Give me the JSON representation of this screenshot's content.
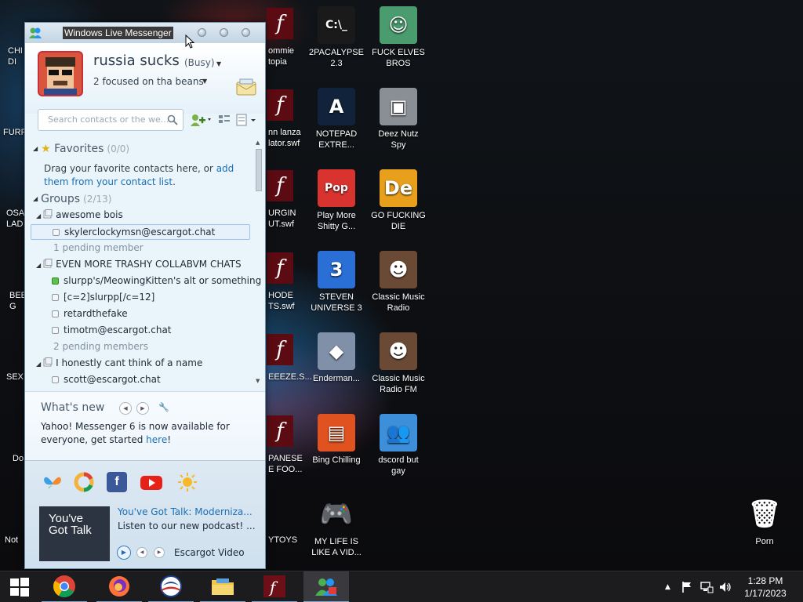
{
  "desktop": {
    "left_partial_labels": [
      {
        "text": "CHI\nDI"
      },
      {
        "text": "FURR"
      },
      {
        "text": "OSA\nLAD"
      },
      {
        "text": "BEE\nG"
      },
      {
        "text": "SEX"
      },
      {
        "text": "Do"
      },
      {
        "text": "Not"
      }
    ],
    "mid_partial_labels": [
      {
        "text": "ommie\ntopia"
      },
      {
        "text": "nn lanza\nlator.swf"
      },
      {
        "text": "URGIN\nUT.swf"
      },
      {
        "text": "HODE\nTS.swf"
      },
      {
        "text": "EEEZE.S..."
      },
      {
        "text": "PANESE\nE FOO..."
      },
      {
        "text": "YTOYS"
      }
    ],
    "icons": [
      {
        "label": "2PACALYPSE\n2.3",
        "icon": "cmd-icon",
        "color": "#1a1a1a"
      },
      {
        "label": "FUCK ELVES\nBROS",
        "icon": "elf-icon",
        "color": "#4a9b6e"
      },
      {
        "label": "NOTEPAD\nEXTRE...",
        "icon": "notepad-icon",
        "color": "#10233a"
      },
      {
        "label": "Deez Nutz\nSpy",
        "icon": "windows-stack-icon",
        "color": "#8a8f96"
      },
      {
        "label": "Play More\nShitty G...",
        "icon": "popcap-icon",
        "color": "#d8332f"
      },
      {
        "label": "GO FUCKING\nDIE",
        "icon": "de-icon",
        "color": "#e8a01c"
      },
      {
        "label": "STEVEN\nUNIVERSE 3",
        "icon": "three-badge-icon",
        "color": "#2a6fd6"
      },
      {
        "label": "Classic Music\nRadio",
        "icon": "portrait-icon",
        "color": "#6b4a35"
      },
      {
        "label": "Enderman...",
        "icon": "diamond-icon",
        "color": "#7f90a8"
      },
      {
        "label": "Classic Music\nRadio FM",
        "icon": "portrait-fm-icon",
        "color": "#6b4a35"
      },
      {
        "label": "Bing Chilling",
        "icon": "book-icon",
        "color": "#e0521f"
      },
      {
        "label": "dscord but\ngay",
        "icon": "messenger-people-icon",
        "color": "#3c8fd8"
      },
      {
        "label": "MY LIFE IS\nLIKE A VID...",
        "icon": "gamepad-icon",
        "color": "#e8e8e8"
      },
      {
        "label": "Porn",
        "icon": "recycle-bin-icon",
        "color": "#dfe4e8"
      }
    ]
  },
  "messenger": {
    "window_title": "Windows Live Messenger",
    "username": "russia sucks",
    "status": "(Busy)",
    "personal_message": "2 focused on tha beans",
    "search_placeholder": "Search contacts or the we...",
    "favorites": {
      "title": "Favorites",
      "count": "(0/0)",
      "text_before": "Drag your favorite contacts here, or ",
      "link": "add them from your contact list",
      "text_after": "."
    },
    "groups": {
      "title": "Groups",
      "count": "(2/13)",
      "list": [
        {
          "name": "awesome bois",
          "contacts": [
            {
              "name": "skylerclockymsn@escargot.chat",
              "online": false,
              "selected": true
            }
          ],
          "pending": "1 pending member"
        },
        {
          "name": "EVEN MORE TRASHY COLLABVM CHATS",
          "contacts": [
            {
              "name": "slurpp's/MeowingKitten's alt or something",
              "online": true
            },
            {
              "name": "[c=2]slurpp[/c=12]",
              "online": false
            },
            {
              "name": "retardthefake",
              "online": false
            },
            {
              "name": "timotm@escargot.chat",
              "online": false
            }
          ],
          "pending": "2 pending members"
        },
        {
          "name": "I honestly cant think of a name",
          "contacts": [
            {
              "name": "scott@escargot.chat",
              "online": false
            }
          ]
        }
      ]
    },
    "whats_new": {
      "title": "What's new",
      "text": "Yahoo! Messenger 6 is now available for everyone, get started ",
      "link": "here",
      "text_after": "!"
    },
    "social_icons": [
      "windows-live-butterfly-icon",
      "chrome-c-icon",
      "facebook-icon",
      "youtube-icon",
      "sun-icon"
    ],
    "promo": {
      "thumb_text": "You've Got Talk",
      "title": "You've Got Talk: Moderniza...",
      "subtitle": "Listen to our new podcast! ...",
      "source": "Escargot Video"
    }
  },
  "taskbar": {
    "apps": [
      {
        "name": "start-button",
        "icon": "windows-logo-icon"
      },
      {
        "name": "chrome",
        "icon": "chrome-icon"
      },
      {
        "name": "firefox",
        "icon": "firefox-icon"
      },
      {
        "name": "obama",
        "icon": "obama-logo-icon"
      },
      {
        "name": "file-explorer",
        "icon": "folder-icon"
      },
      {
        "name": "flash",
        "icon": "flash-icon"
      },
      {
        "name": "messenger",
        "icon": "messenger-people-icon"
      }
    ],
    "tray_icons": [
      "chevron-up-icon",
      "flag-icon",
      "network-icon",
      "speaker-icon"
    ],
    "time": "1:28 PM",
    "date": "1/17/2023"
  }
}
